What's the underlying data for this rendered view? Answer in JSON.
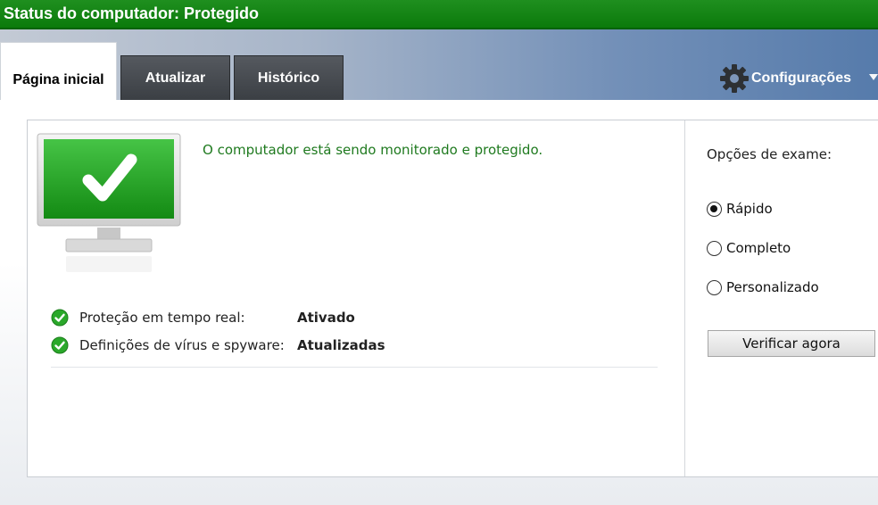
{
  "window": {
    "title": "Status do computador: Protegido"
  },
  "tabs": [
    {
      "label": "Página inicial",
      "active": true
    },
    {
      "label": "Atualizar",
      "active": false
    },
    {
      "label": "Histórico",
      "active": false
    }
  ],
  "settings": {
    "label": "Configurações",
    "icon": "gear-icon"
  },
  "status": {
    "message": "O computador está sendo monitorado e protegido.",
    "items": [
      {
        "label": "Proteção em tempo real:",
        "value": "Ativado",
        "icon": "green-check-icon"
      },
      {
        "label": "Definições de vírus e spyware:",
        "value": "Atualizadas",
        "icon": "green-check-icon"
      }
    ]
  },
  "scan": {
    "title": "Opções de exame:",
    "options": [
      {
        "label": "Rápido",
        "selected": true
      },
      {
        "label": "Completo",
        "selected": false
      },
      {
        "label": "Personalizado",
        "selected": false
      }
    ],
    "button_label": "Verificar agora"
  },
  "colors": {
    "titlebar": "#0b7a0b",
    "status_text": "#1f7a1f",
    "accent_check": "#2aa82a"
  }
}
